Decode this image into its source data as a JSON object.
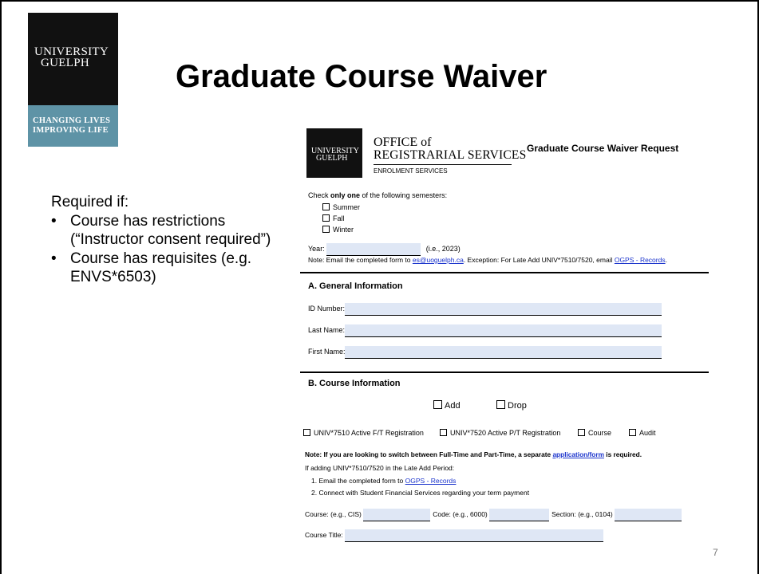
{
  "brand": {
    "wordmark_line1": "UNIVERSITY",
    "wordmark_line2": "GUELPH",
    "tagline_line1": "CHANGING LIVES",
    "tagline_line2": "IMPROVING LIFE"
  },
  "slide": {
    "title": "Graduate Course Waiver",
    "page_number": "7"
  },
  "left_list": {
    "intro": "Required if:",
    "items": [
      "Course has restrictions (“Instructor consent required”)",
      "Course has requisites (e.g. ENVS*6503)"
    ]
  },
  "form": {
    "logo": {
      "line1": "UNIVERSITY",
      "line2": "GUELPH"
    },
    "office_line1": "OFFICE of",
    "office_line2": "REGISTRARIAL SERVICES",
    "office_line3": "ENROLMENT SERVICES",
    "title": "Graduate Course Waiver Request",
    "semester_prompt_pre": "Check ",
    "semester_prompt_bold": "only one",
    "semester_prompt_post": " of the following semesters:",
    "semesters": [
      "Summer",
      "Fall",
      "Winter"
    ],
    "year_label": "Year:",
    "year_hint": "(i.e., 2023)",
    "note_pre": "Note: Email the completed form to ",
    "note_email": "es@uoguelph.ca",
    "note_mid": ". Exception: For Late Add UNIV*7510/7520, email ",
    "note_link": "OGPS - Records",
    "note_end": ".",
    "section_a": "A. General Information",
    "fields_a": [
      "ID Number:",
      "Last Name:",
      "First Name:"
    ],
    "section_b": "B. Course Information",
    "add_label": "Add",
    "drop_label": "Drop",
    "reg_options": [
      "UNIV*7510 Active F/T Registration",
      "UNIV*7520 Active P/T Registration",
      "Course",
      "Audit"
    ],
    "switch_note_pre": "Note: If you are looking to switch between Full-Time and Part-Time, a separate ",
    "switch_note_link": "application/form",
    "switch_note_post": " is required.",
    "late_add_intro": "If adding UNIV*7510/7520 in the Late Add Period:",
    "step1_pre": "1. Email the completed form to ",
    "step1_link": "OGPS - Records",
    "step2": "2. Connect with Student Financial Services regarding your term payment",
    "course_label": "Course: (e.g., CIS)",
    "code_label": "Code: (e.g., 6000)",
    "section_label": "Section: (e.g., 0104)",
    "course_title_label": "Course Title:"
  }
}
